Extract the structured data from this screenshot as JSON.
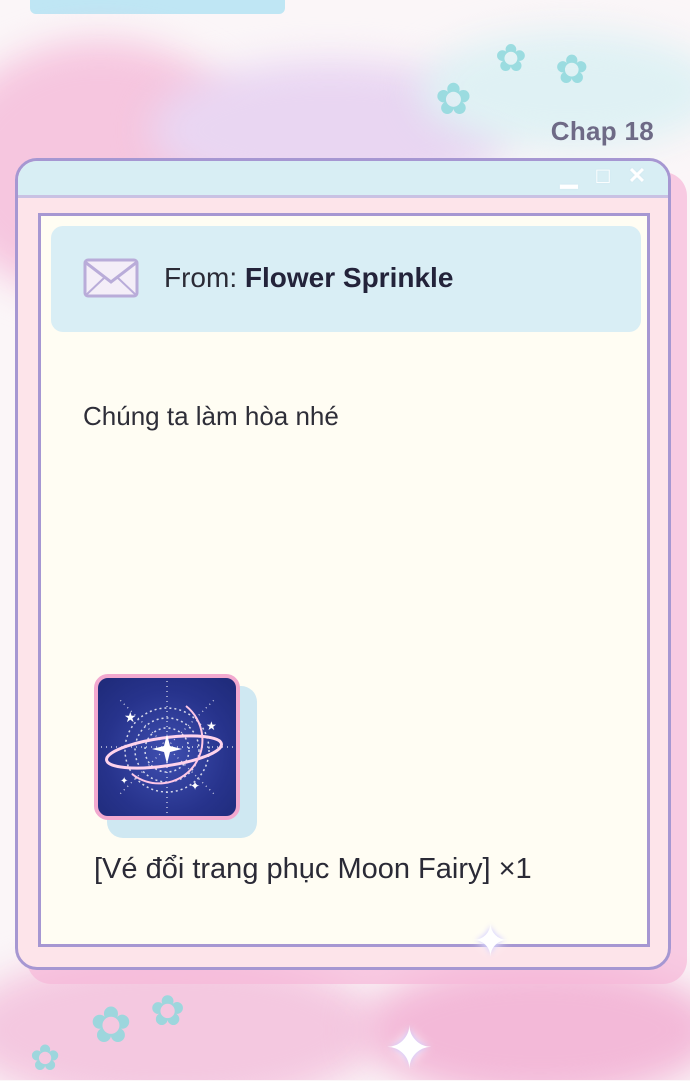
{
  "chapter": "Chap 18",
  "window": {
    "buttons": [
      {
        "name": "minimize",
        "glyph": "▁"
      },
      {
        "name": "maximize",
        "glyph": "□"
      },
      {
        "name": "close",
        "glyph": "✕"
      }
    ]
  },
  "mail": {
    "from_label": "From: ",
    "sender": "Flower Sprinkle",
    "icon": "envelope-icon"
  },
  "message": "Chúng ta làm hòa nhé",
  "attachment": {
    "icon": "moon-fairy-ticket-icon",
    "caption": "[Vé đổi trang phục Moon Fairy] ×1"
  },
  "colors": {
    "window_border": "#a697d2",
    "window_bg": "#fde4ea",
    "titlebar": "#d8eef4",
    "from_box": "#d9eef5",
    "content_bg": "#fffdf3",
    "accent_pink": "#f2a9cf"
  }
}
